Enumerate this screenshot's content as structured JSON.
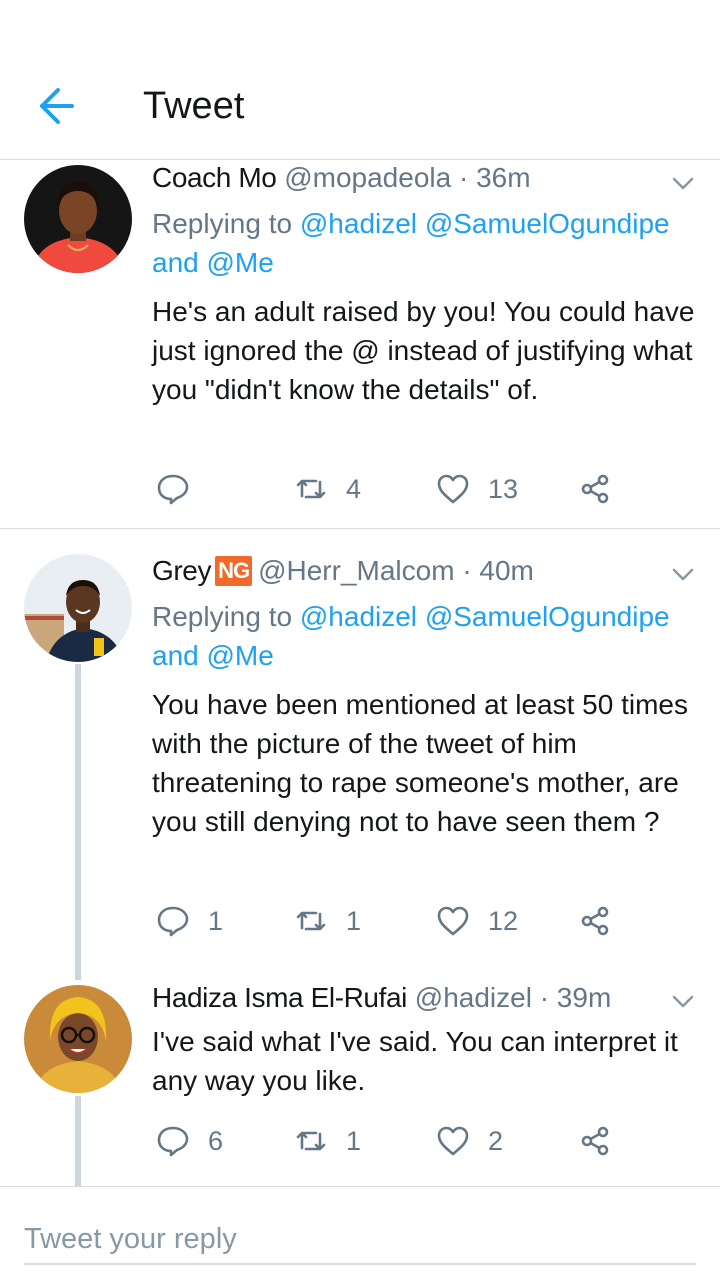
{
  "header": {
    "title": "Tweet"
  },
  "colors": {
    "accent": "#1da1f2",
    "secondary_text": "#657786",
    "divider": "#d8dde1",
    "badge": "#f26a2a"
  },
  "tweets": [
    {
      "name": "Coach Mo",
      "handle": "@mopadeola",
      "time": "· 36m",
      "replying_prefix": "Replying to",
      "mentions": [
        "@hadizel",
        "@SamuelOgundipe"
      ],
      "and_word": "and",
      "last_mention": "@Me",
      "text": "He's an adult raised by you! You could have just ignored the @ instead of justifying what you \"didn't know the details\" of.",
      "replies": "",
      "retweets": "4",
      "likes": "13"
    },
    {
      "name": "Grey",
      "badge": "NG",
      "handle": "@Herr_Malcom",
      "time": "· 40m",
      "replying_prefix": "Replying to",
      "mentions": [
        "@hadizel",
        "@SamuelOgundipe"
      ],
      "and_word": "and",
      "last_mention": "@Me",
      "text": "You have been mentioned at least 50 times with the picture of the tweet of him threatening to rape someone's mother, are you still denying not to have seen them ?",
      "replies": "1",
      "retweets": "1",
      "likes": "12"
    },
    {
      "name": "Hadiza Isma El-Rufai",
      "handle": "@hadizel",
      "time": "· 39m",
      "text": "I've said what I've said. You can interpret it any way you like.",
      "replies": "6",
      "retweets": "1",
      "likes": "2"
    }
  ],
  "reply_bar": {
    "placeholder": "Tweet your reply"
  }
}
